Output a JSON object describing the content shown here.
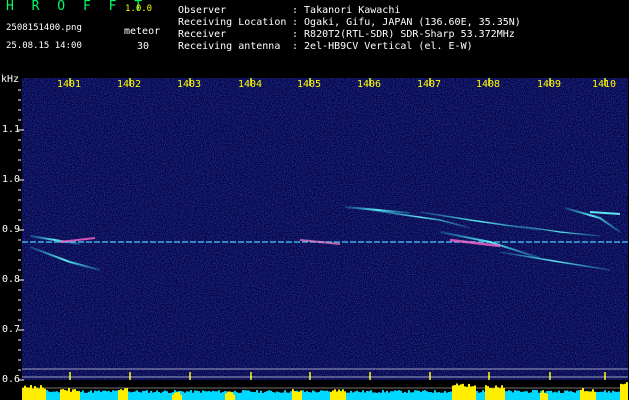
{
  "header": {
    "app_title": "H R O F F T",
    "version": "1.0.0",
    "filename": "2508151400.png",
    "datetime": "25.08.15 14:00",
    "meteor_label": "meteor",
    "meteor_count": "30"
  },
  "info": [
    {
      "label": "Observer",
      "value": ": Takanori Kawachi"
    },
    {
      "label": "Receiving Location",
      "value": ": Ogaki, Gifu, JAPAN (136.60E, 35.35N)"
    },
    {
      "label": "Receiver",
      "value": ": R820T2(RTL-SDR) SDR-Sharp 53.372MHz"
    },
    {
      "label": "Receiving antenna",
      "value": ": 2el-HB9CV Vertical (el. E-W)"
    }
  ],
  "axis": {
    "unit": "kHz",
    "x_ticks": [
      "1401",
      "1402",
      "1403",
      "1404",
      "1405",
      "1406",
      "1407",
      "1408",
      "1409",
      "1410"
    ],
    "y_ticks": [
      "1.1",
      "1.0",
      "0.9",
      "0.8",
      "0.7",
      "0.6"
    ]
  },
  "colors": {
    "background": "#000000",
    "noise": "#0a0a6e",
    "signal": "#33ddff",
    "tick": "#ffff00",
    "label": "#ffffff",
    "title": "#00ff66"
  }
}
